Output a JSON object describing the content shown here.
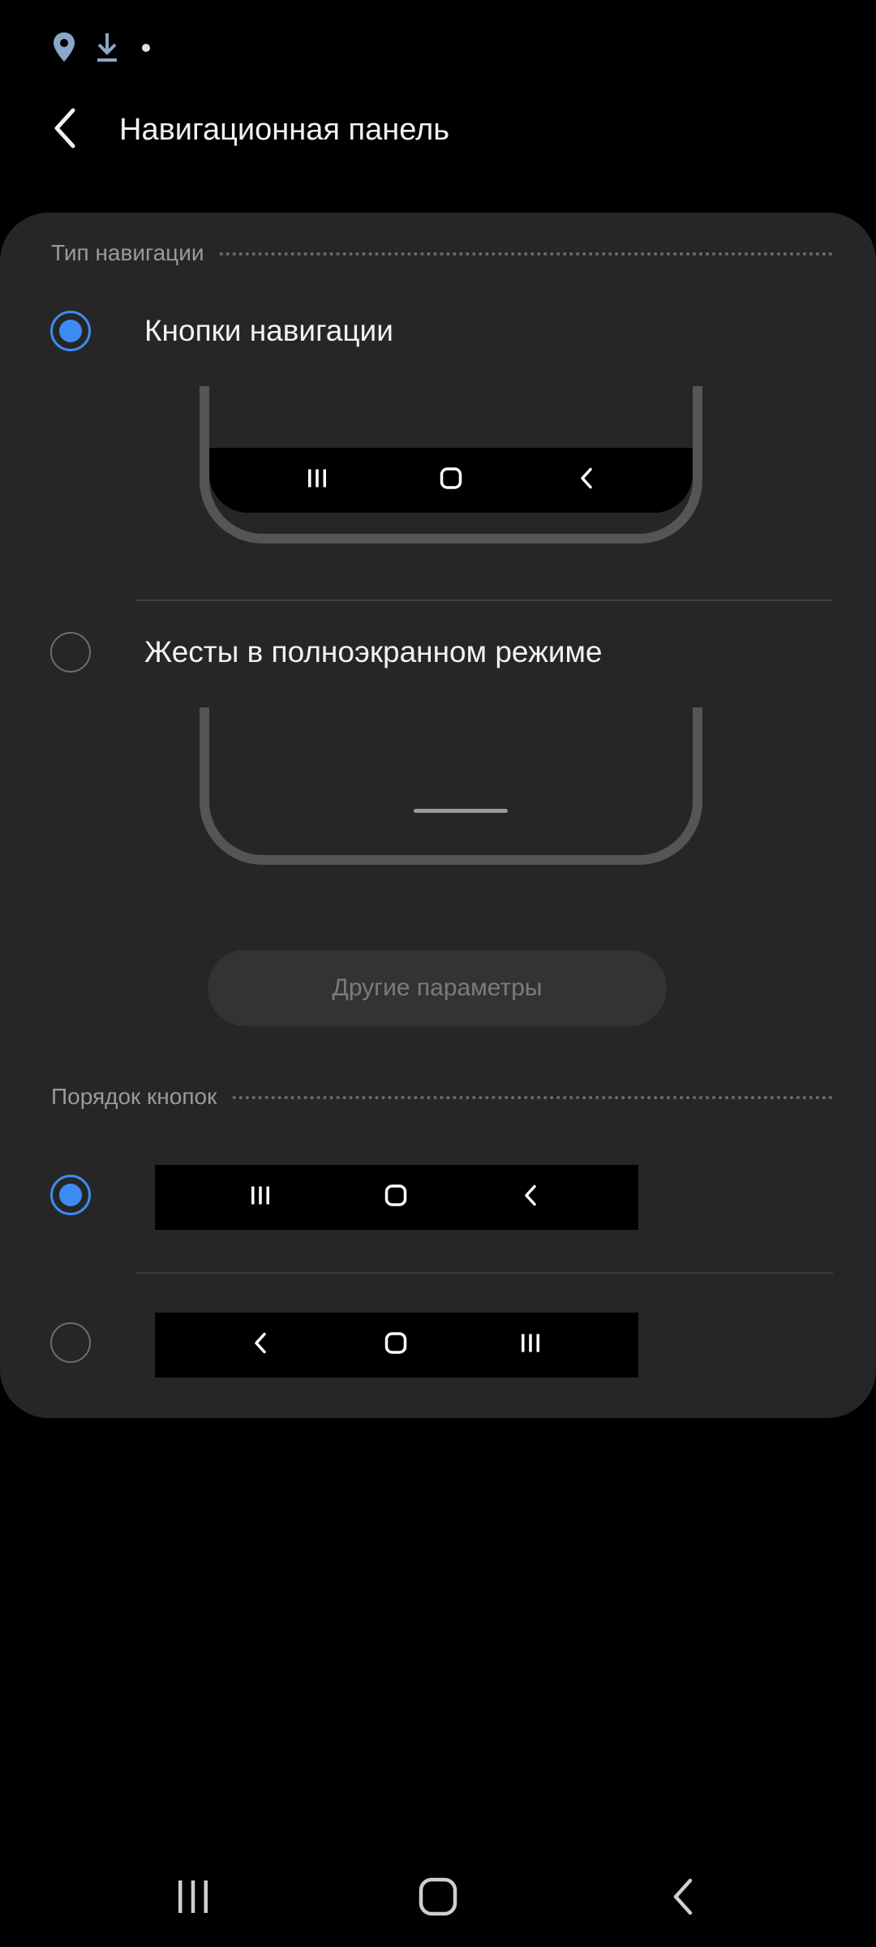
{
  "status_bar": {
    "icons": [
      "location-icon",
      "download-icon",
      "notification-dot-icon"
    ]
  },
  "header": {
    "title": "Навигационная панель",
    "back_icon": "back-arrow-icon"
  },
  "nav_type_section": {
    "label": "Тип навигации",
    "options": [
      {
        "label": "Кнопки навигации",
        "selected": true,
        "preview": "buttons"
      },
      {
        "label": "Жесты в полноэкранном режиме",
        "selected": false,
        "preview": "gestures"
      }
    ],
    "more_button_label": "Другие параметры"
  },
  "button_order_section": {
    "label": "Порядок кнопок",
    "options": [
      {
        "order": [
          "recents-icon",
          "home-icon",
          "back-icon"
        ],
        "selected": true
      },
      {
        "order": [
          "back-icon",
          "home-icon",
          "recents-icon"
        ],
        "selected": false
      }
    ]
  },
  "system_nav": {
    "buttons": [
      "recents-icon",
      "home-icon",
      "back-icon"
    ]
  },
  "colors": {
    "accent": "#3d8bf3",
    "background": "#000000",
    "card": "#262626"
  }
}
